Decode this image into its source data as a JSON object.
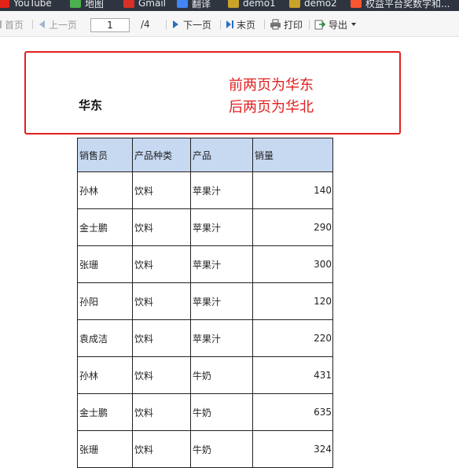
{
  "bookmarks": [
    {
      "label": "YouTube",
      "icon": "youtube-icon",
      "color": "#e62117"
    },
    {
      "label": "地图",
      "icon": "maps-icon",
      "color": "#4caf50"
    },
    {
      "label": "Gmail",
      "icon": "gmail-icon",
      "color": "#d93025"
    },
    {
      "label": "翻译",
      "icon": "translate-icon",
      "color": "#4285f4"
    },
    {
      "label": "demo1",
      "icon": "image-icon",
      "color": "#c9a227"
    },
    {
      "label": "demo2",
      "icon": "image-icon",
      "color": "#c9a227"
    },
    {
      "label": "权益平台奖数字和...",
      "icon": "csdn-icon",
      "color": "#fc5531"
    }
  ],
  "toolbar": {
    "first_page": "首页",
    "prev_page": "上一页",
    "current_page": "1",
    "total_pages": "/4",
    "next_page": "下一页",
    "last_page": "末页",
    "print": "打印",
    "export": "导出"
  },
  "report": {
    "region_title": "华东",
    "annotation_lines": [
      "前两页为华东",
      "后两页为华北"
    ],
    "columns": [
      "销售员",
      "产品种类",
      "产品",
      "销量"
    ],
    "rows": [
      [
        "孙林",
        "饮料",
        "苹果汁",
        "140"
      ],
      [
        "金士鹏",
        "饮料",
        "苹果汁",
        "290"
      ],
      [
        "张珊",
        "饮料",
        "苹果汁",
        "300"
      ],
      [
        "孙阳",
        "饮料",
        "苹果汁",
        "120"
      ],
      [
        "袁成洁",
        "饮料",
        "苹果汁",
        "220"
      ],
      [
        "孙林",
        "饮料",
        "牛奶",
        "431"
      ],
      [
        "金士鹏",
        "饮料",
        "牛奶",
        "635"
      ],
      [
        "张珊",
        "饮料",
        "牛奶",
        "324"
      ]
    ]
  },
  "colors": {
    "annotation": "#e02020",
    "header_fill": "#c6d9f1",
    "toolbar_icon": "#2a6fc0"
  }
}
